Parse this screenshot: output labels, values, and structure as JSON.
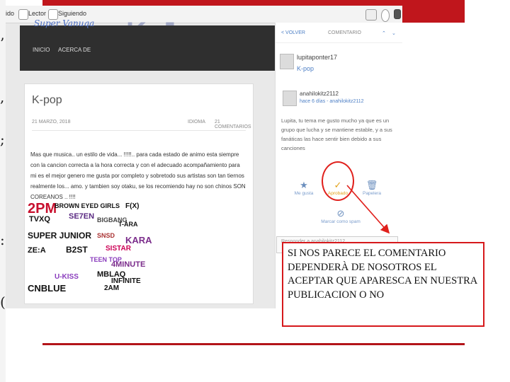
{
  "browser": {
    "item1": "ido",
    "item2": "Lector",
    "item3": "Siguiendo",
    "icon_name": "user-icon"
  },
  "blog": {
    "header_text": "Super Vanuqa",
    "nav_home": "INICIO",
    "nav_about": "ACERCA DE"
  },
  "post": {
    "title": "K-pop",
    "date": "21 MARZO, 2018",
    "author": "IDIOMA",
    "comments_count": "21 COMENTARIOS",
    "body": "Mas que musica.. un estilo de vida... !!!!!.. para cada estado de animo esta siempre con la cancion correcta a la hora correcta y con el adecuado acompañamiento para mi es el mejor genero me gusta por completo y sobretodo sus artistas son tan tiernos realmente los... amo. y tambien soy otaku, se los recomiendo hay no son chinos SON COREANOS .. !!!!",
    "groups": [
      "2PM",
      "BROWN EYED GIRLS",
      "TVXQ",
      "SE7EN",
      "BIGBANG",
      "SUPER JUNIOR",
      "ZE:A",
      "B2ST",
      "CNBLUE",
      "INFINITE",
      "MBLAQ",
      "TEEN TOP",
      "U-KISS",
      "F(X)",
      "KARA",
      "T-ARA",
      "2AM",
      "4MINUTE",
      "SNSD",
      "SISTAR"
    ]
  },
  "comments": {
    "back_label": "< VOLVER",
    "tab_label": "COMENTARIO",
    "post_author": "lupitaponter17",
    "post_title": "K-pop",
    "commenter": "anahilokitz2112",
    "comment_time": "hace 6 días - anahilokitz2112",
    "comment_text": "Lupita, tu tema me gusto mucho ya que es un grupo que lucha y se mantiene estable, y a sus fanáticas las hace sentir bien debido a sus canciones",
    "action_like": "Me gusta",
    "action_approve": "Aprobado",
    "action_trash": "Papelera",
    "action_spam": "Marcar como spam",
    "reply_placeholder": "Responder a anahilokitz2112"
  },
  "callout": {
    "text": "SI NOS PARECE EL COMENTARIO DEPENDERÀ DE NOSOTROS EL ACEPTAR QUE APARESCA EN NUESTRA PUBLICACION O NO"
  },
  "colors": {
    "accent_red": "#c0161c",
    "link_blue": "#4d7fc5",
    "header_dark": "#2f2f2f"
  }
}
